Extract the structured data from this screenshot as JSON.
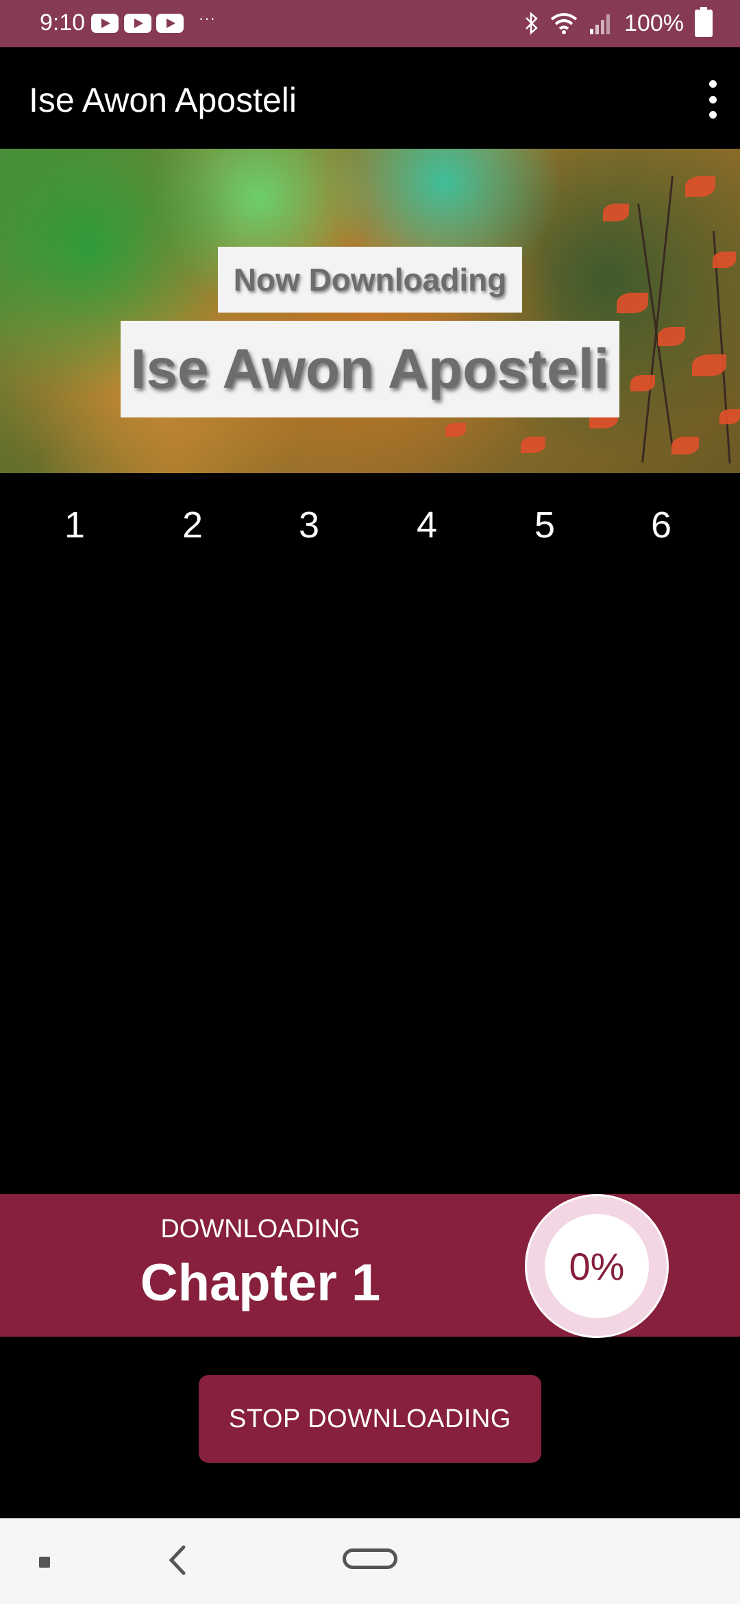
{
  "status_bar": {
    "time": "9:10",
    "notification_icons": [
      "youtube-icon",
      "youtube-icon",
      "youtube-icon"
    ],
    "more_dots": "···",
    "battery_text": "100%",
    "background_color": "#873a55"
  },
  "app_bar": {
    "title": "Ise Awon Aposteli",
    "overflow_icon": "more-vert-icon"
  },
  "banner": {
    "subtitle": "Now Downloading",
    "title": "Ise Awon Aposteli"
  },
  "chapters": [
    "1",
    "2",
    "3",
    "4",
    "5",
    "6"
  ],
  "download_panel": {
    "label": "DOWNLOADING",
    "chapter": "Chapter 1",
    "progress_text": "0%",
    "progress_value": 0,
    "accent_color": "#86203d"
  },
  "stop_button": {
    "label": "STOP DOWNLOADING"
  },
  "nav_bar": {
    "icons": [
      "recent-apps-icon",
      "back-icon",
      "home-icon"
    ]
  }
}
